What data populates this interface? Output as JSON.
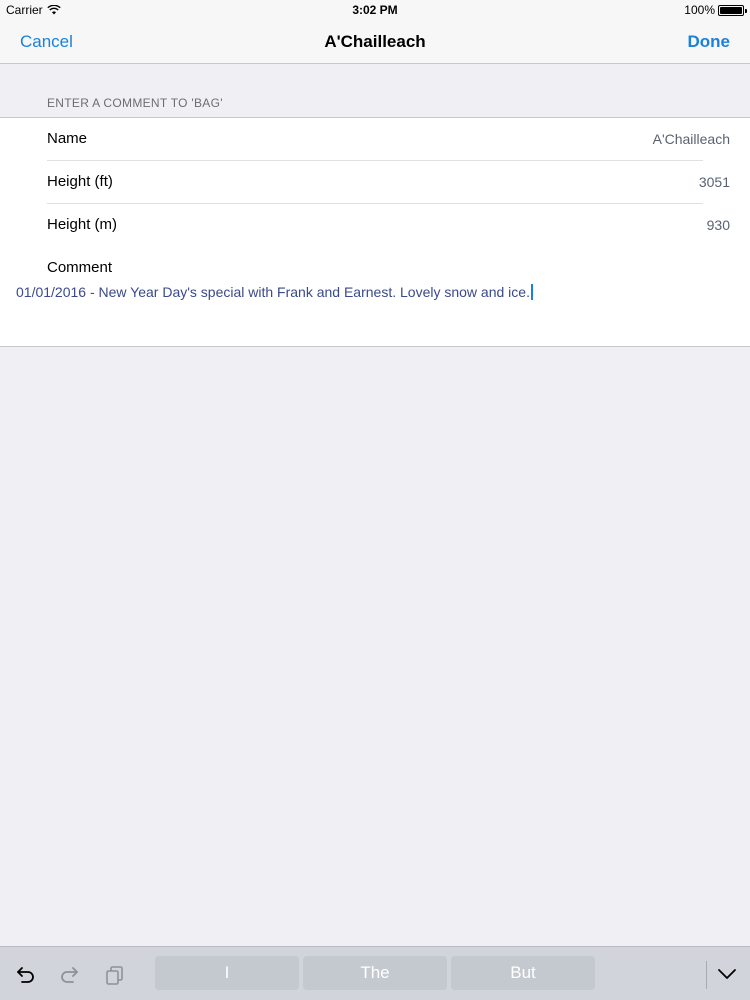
{
  "status_bar": {
    "carrier": "Carrier",
    "time": "3:02 PM",
    "battery_percent": "100%"
  },
  "nav": {
    "cancel_label": "Cancel",
    "title": "A'Chailleach",
    "done_label": "Done"
  },
  "form": {
    "section_header": "ENTER A COMMENT TO 'BAG'",
    "rows": [
      {
        "label": "Name",
        "value": "A'Chailleach"
      },
      {
        "label": "Height (ft)",
        "value": "3051"
      },
      {
        "label": "Height (m)",
        "value": "930"
      }
    ],
    "comment_label": "Comment",
    "comment_value": "01/01/2016 - New Year Day's special with Frank and Earnest. Lovely snow and ice."
  },
  "keyboard_bar": {
    "suggestions": [
      "I",
      "The",
      "But"
    ],
    "icons": [
      "undo-icon",
      "redo-icon",
      "copy-icon",
      "chevron-down-icon"
    ]
  },
  "colors": {
    "accent": "#1a82db",
    "background": "#efeff4",
    "value_text": "#5a6271",
    "comment_text": "#3a4a8a"
  }
}
